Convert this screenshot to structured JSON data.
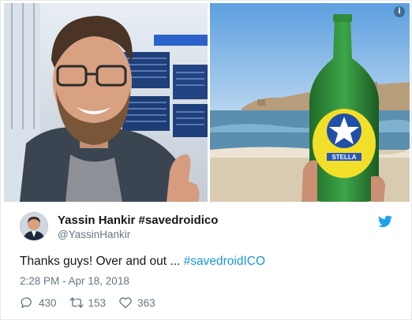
{
  "tweet": {
    "author_name": "Yassin Hankir #savedroidico",
    "author_handle": "@YassinHankir",
    "text_prefix": "Thanks guys! Over and out ... ",
    "hashtag": "#savedroidICO",
    "timestamp": "2:28 PM - Apr 18, 2018",
    "media_info": "i",
    "bottle_label": "STELLA"
  },
  "actions": {
    "reply_count": "430",
    "retweet_count": "153",
    "like_count": "363"
  },
  "colors": {
    "link": "#1b95e0",
    "secondary_text": "#657786",
    "twitter_blue": "#1da1f2"
  },
  "icons": [
    "info-icon",
    "twitter-bird-icon",
    "reply-icon",
    "retweet-icon",
    "like-icon"
  ]
}
